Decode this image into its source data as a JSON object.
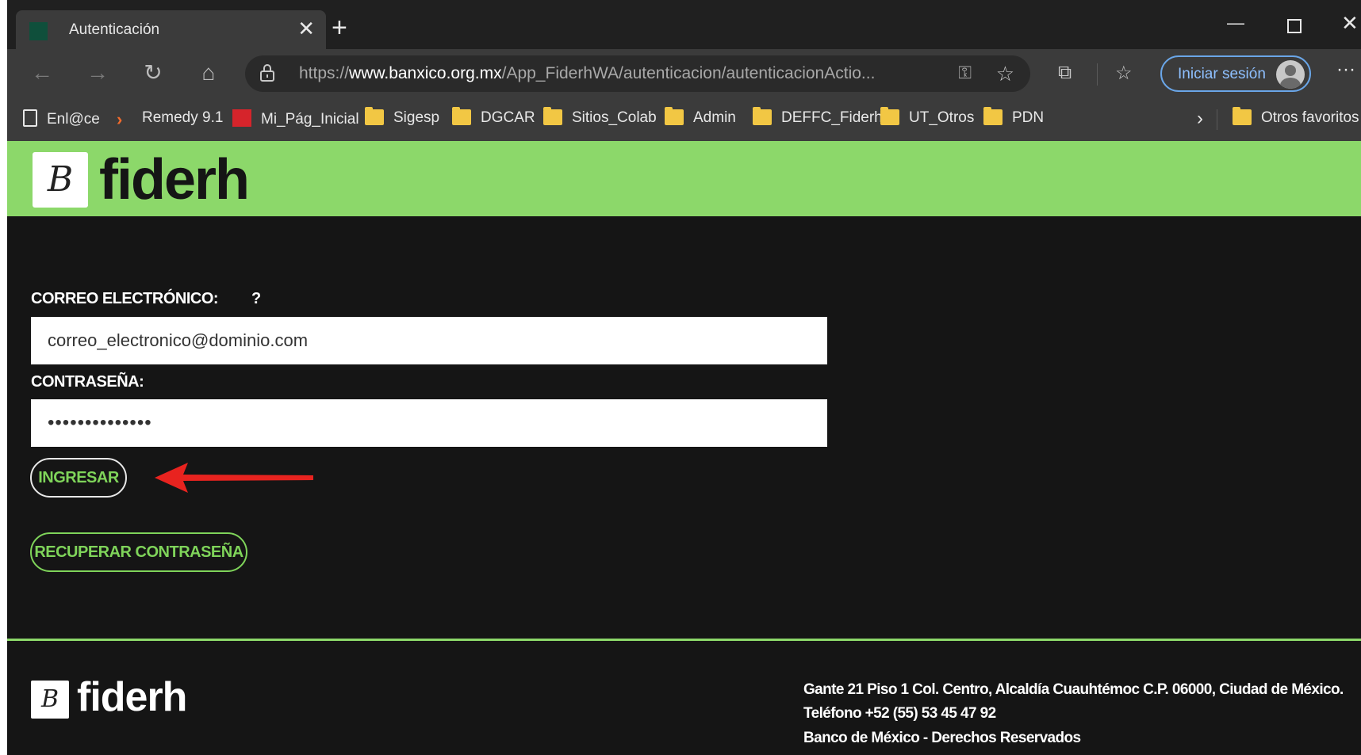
{
  "browser": {
    "tab_title": "Autenticación",
    "tab_close": "✕",
    "new_tab": "+",
    "url_prefix": "https://",
    "url_host": "www.banxico.org.mx",
    "url_path": "/App_FiderhWA/autenticacion/autenticacionActio...",
    "signin_label": "Iniciar sesión",
    "more": "···",
    "bookmarks": [
      "Enl@ce",
      "Remedy 9.1",
      "Mi_Pág_Inicial",
      "Sigesp",
      "DGCAR",
      "Sitios_Colab",
      "Admin",
      "DEFFC_Fiderh",
      "UT_Otros",
      "PDN"
    ],
    "other_favorites": "Otros favoritos",
    "accent_color": "#6aa6e8"
  },
  "header": {
    "logo_text": "fiderh",
    "logo_mark": "B",
    "brand_color": "#8cd86a"
  },
  "form": {
    "email_label": "CORREO ELECTRÓNICO:",
    "email_help": "?",
    "email_value": "correo_electronico@dominio.com",
    "password_label": "CONTRASEÑA:",
    "password_value": "••••••••••••••",
    "login_button": "INGRESAR",
    "recover_button": "RECUPERAR CONTRASEÑA",
    "button_text_color": "#7fd45a",
    "annotation_arrow_color": "#e8231f"
  },
  "footer": {
    "logo_text": "fiderh",
    "logo_mark": "B",
    "address": "Gante 21 Piso 1 Col. Centro, Alcaldía Cuauhtémoc C.P. 06000, Ciudad de México.",
    "phone": "Teléfono +52 (55) 53 45 47 92",
    "copyright": "Banco de México - Derechos Reservados"
  }
}
